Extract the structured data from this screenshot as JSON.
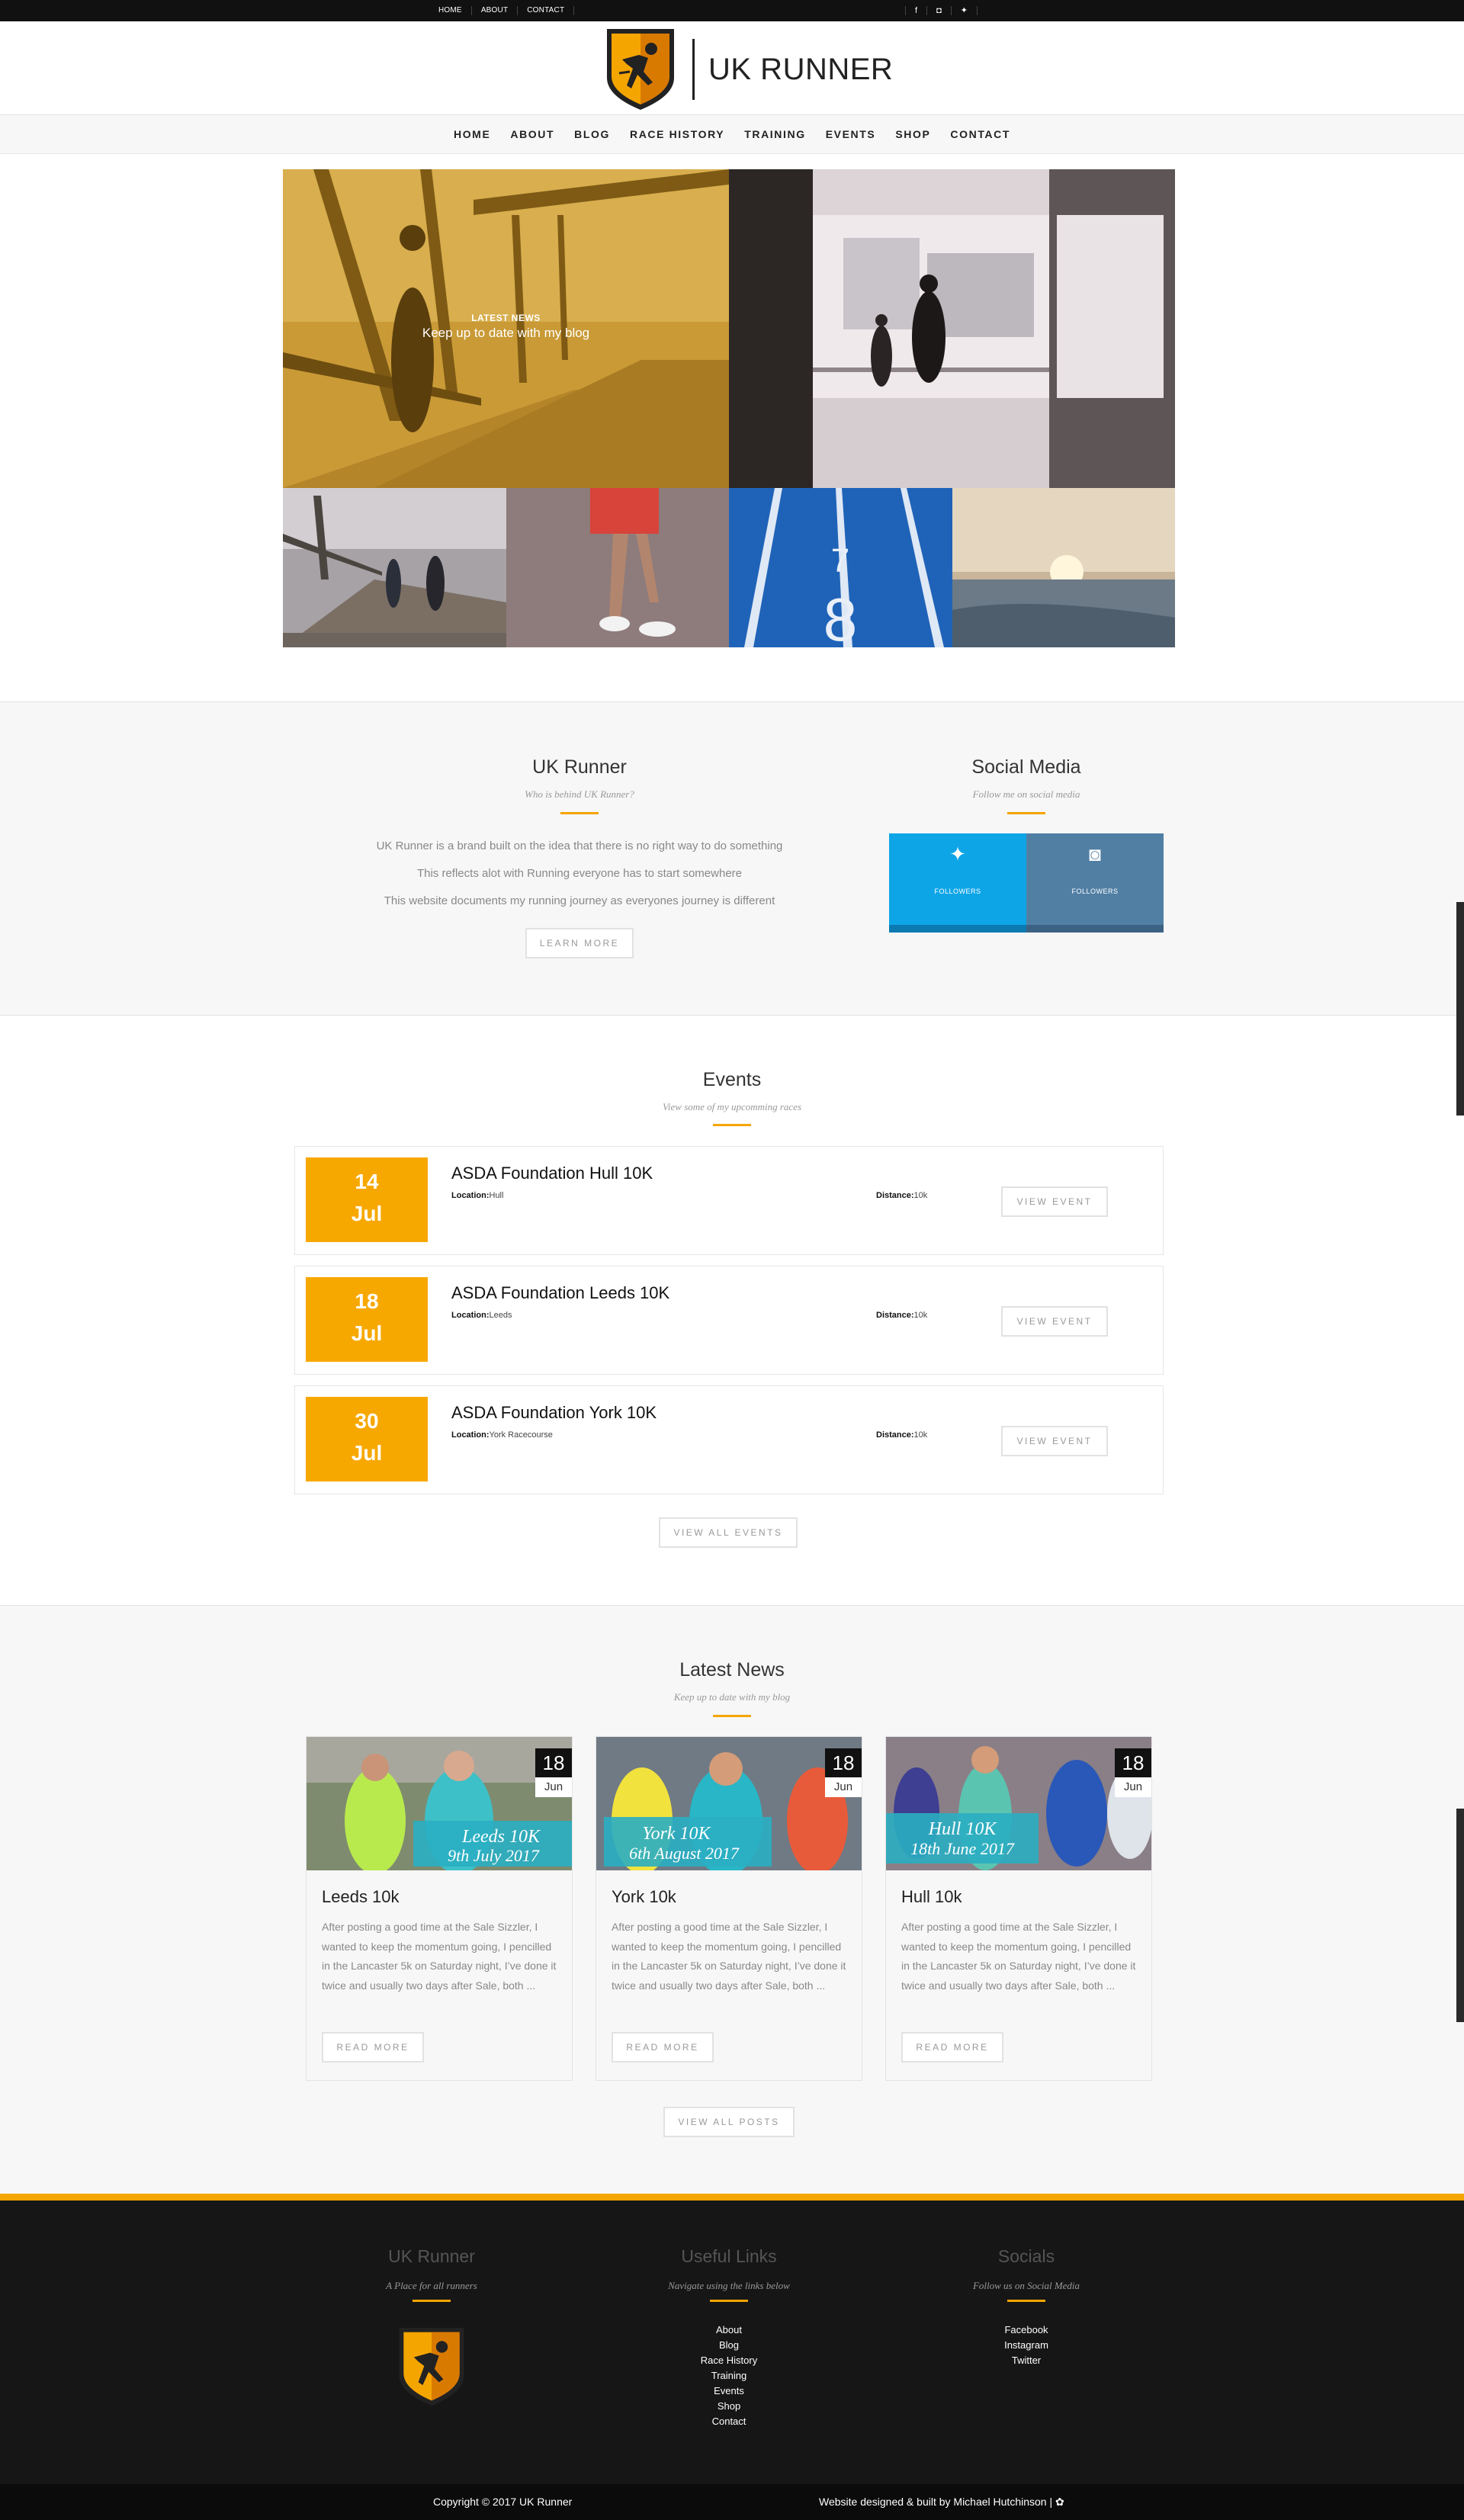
{
  "topbar": {
    "links": [
      "HOME",
      "ABOUT",
      "CONTACT"
    ],
    "social_icons": [
      "facebook-icon",
      "instagram-icon",
      "twitter-icon"
    ]
  },
  "brand": {
    "name": "UK RUNNER"
  },
  "nav": [
    "HOME",
    "ABOUT",
    "BLOG",
    "RACE HISTORY",
    "TRAINING",
    "EVENTS",
    "SHOP",
    "CONTACT"
  ],
  "hero": {
    "kicker": "LATEST NEWS",
    "tagline": "Keep up to date with my blog"
  },
  "about": {
    "title": "UK Runner",
    "subtitle": "Who is behind UK Runner?",
    "lines": [
      "UK Runner is a brand built on the idea that there is no right way to do something",
      "This reflects alot with Running everyone has to start somewhere",
      "This website documents my running journey as everyones journey is different"
    ],
    "button": "LEARN MORE"
  },
  "social": {
    "title": "Social Media",
    "subtitle": "Follow me on social media",
    "twitter_label": "FOLLOWERS",
    "instagram_label": "FOLLOWERS",
    "colors": {
      "twitter": "#0ea5e7",
      "instagram": "#517fa4"
    }
  },
  "events": {
    "title": "Events",
    "subtitle": "View some of my upcomming races",
    "location_label": "Location:",
    "distance_label": "Distance:",
    "button": "VIEW EVENT",
    "items": [
      {
        "day": "14",
        "month": "Jul",
        "name": "ASDA Foundation Hull 10K",
        "location": "Hull",
        "distance": "10k"
      },
      {
        "day": "18",
        "month": "Jul",
        "name": "ASDA Foundation Leeds 10K",
        "location": "Leeds",
        "distance": "10k"
      },
      {
        "day": "30",
        "month": "Jul",
        "name": "ASDA Foundation York 10K",
        "location": "York Racecourse",
        "distance": "10k"
      }
    ],
    "view_all": "VIEW ALL EVENTS"
  },
  "news": {
    "title": "Latest News",
    "subtitle": "Keep up to date with my blog",
    "button": "READ MORE",
    "posts": [
      {
        "day": "18",
        "month": "Jun",
        "title": "Leeds 10k",
        "banner1": "Leeds 10K",
        "banner2": "9th July 2017",
        "excerpt": "After posting a good time at the Sale Sizzler, I wanted to keep the momentum going, I pencilled in the Lancaster 5k on Saturday night, I’ve done it twice and usually two days after Sale, both ..."
      },
      {
        "day": "18",
        "month": "Jun",
        "title": "York 10k",
        "banner1": "York 10K",
        "banner2": "6th August 2017",
        "excerpt": "After posting a good time at the Sale Sizzler, I wanted to keep the momentum going, I pencilled in the Lancaster 5k on Saturday night, I’ve done it twice and usually two days after Sale, both ..."
      },
      {
        "day": "18",
        "month": "Jun",
        "title": "Hull 10k",
        "banner1": "Hull 10K",
        "banner2": "18th June 2017",
        "excerpt": "After posting a good time at the Sale Sizzler, I wanted to keep the momentum going, I pencilled in the Lancaster 5k on Saturday night, I’ve done it twice and usually two days after Sale, both ..."
      }
    ],
    "view_all": "VIEW ALL POSTS"
  },
  "footer": {
    "col1": {
      "title": "UK Runner",
      "subtitle": "A Place for all runners"
    },
    "col2": {
      "title": "Useful Links",
      "subtitle": "Navigate using the links below",
      "links": [
        "About",
        "Blog",
        "Race History",
        "Training",
        "Events",
        "Shop",
        "Contact"
      ]
    },
    "col3": {
      "title": "Socials",
      "subtitle": "Follow us on Social Media",
      "links": [
        "Facebook",
        "Instagram",
        "Twitter"
      ]
    },
    "copyright": "Copyright © 2017 UK Runner",
    "credit": "Website designed & built by Michael Hutchinson |",
    "accent": "#f5a500"
  }
}
